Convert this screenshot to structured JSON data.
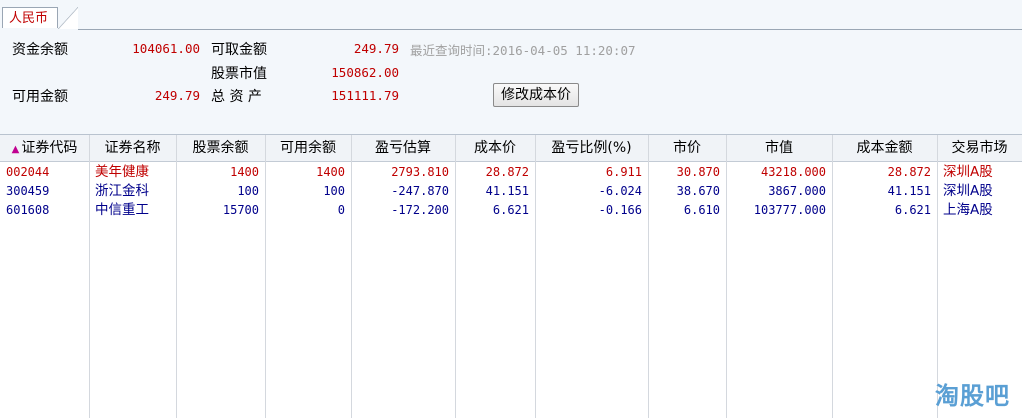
{
  "tab": {
    "label": "人民币"
  },
  "summary": {
    "fund_balance_label": "资金余额",
    "fund_balance": "104061.00",
    "withdrawable_label": "可取金额",
    "withdrawable": "249.79",
    "last_query_label": "最近查询时间:2016-04-05 11:20:07",
    "stock_value_label": "股票市值",
    "stock_value": "150862.00",
    "available_label": "可用金额",
    "available": "249.79",
    "total_assets_label": "总 资 产",
    "total_assets": "151111.79",
    "edit_cost_button": "修改成本价"
  },
  "table": {
    "sort_icon": "▲",
    "columns": [
      "证券代码",
      "证券名称",
      "股票余额",
      "可用余额",
      "盈亏估算",
      "成本价",
      "盈亏比例(%)",
      "市价",
      "市值",
      "成本金额",
      "交易市场"
    ],
    "rows": [
      {
        "code": "002044",
        "name": "美年健康",
        "balance": "1400",
        "available": "1400",
        "pnl": "2793.810",
        "cost": "28.872",
        "pnl_pct": "6.911",
        "price": "30.870",
        "market_value": "43218.000",
        "cost_amount": "28.872",
        "market": "深圳A股",
        "color": "#c00000"
      },
      {
        "code": "300459",
        "name": "浙江金科",
        "balance": "100",
        "available": "100",
        "pnl": "-247.870",
        "cost": "41.151",
        "pnl_pct": "-6.024",
        "price": "38.670",
        "market_value": "3867.000",
        "cost_amount": "41.151",
        "market": "深圳A股",
        "color": "#00008b"
      },
      {
        "code": "601608",
        "name": "中信重工",
        "balance": "15700",
        "available": "0",
        "pnl": "-172.200",
        "cost": "6.621",
        "pnl_pct": "-0.166",
        "price": "6.610",
        "market_value": "103777.000",
        "cost_amount": "6.621",
        "market": "上海A股",
        "color": "#00008b"
      }
    ]
  },
  "watermark": "淘股吧"
}
